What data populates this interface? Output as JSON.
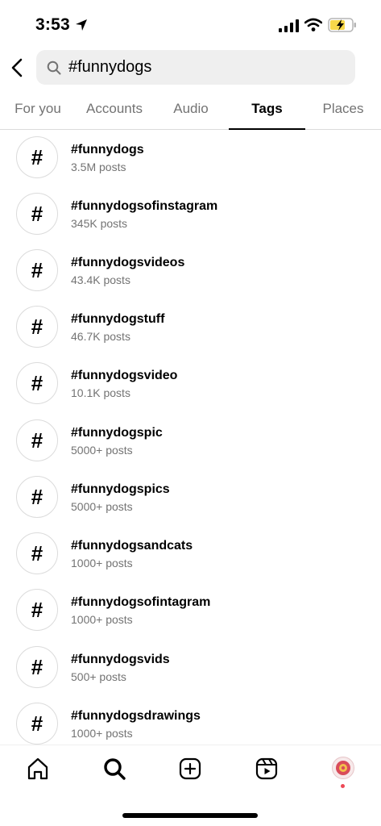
{
  "status_bar": {
    "time": "3:53"
  },
  "search": {
    "query": "#funnydogs"
  },
  "tabs": [
    {
      "label": "For you",
      "active": false
    },
    {
      "label": "Accounts",
      "active": false
    },
    {
      "label": "Audio",
      "active": false
    },
    {
      "label": "Tags",
      "active": true
    },
    {
      "label": "Places",
      "active": false
    }
  ],
  "results": [
    {
      "symbol": "#",
      "name": "#funnydogs",
      "count": "3.5M posts"
    },
    {
      "symbol": "#",
      "name": "#funnydogsofinstagram",
      "count": "345K posts"
    },
    {
      "symbol": "#",
      "name": "#funnydogsvideos",
      "count": "43.4K posts"
    },
    {
      "symbol": "#",
      "name": "#funnydogstuff",
      "count": "46.7K posts"
    },
    {
      "symbol": "#",
      "name": "#funnydogsvideo",
      "count": "10.1K posts"
    },
    {
      "symbol": "#",
      "name": "#funnydogspic",
      "count": "5000+ posts"
    },
    {
      "symbol": "#",
      "name": "#funnydogspics",
      "count": "5000+ posts"
    },
    {
      "symbol": "#",
      "name": "#funnydogsandcats",
      "count": "1000+ posts"
    },
    {
      "symbol": "#",
      "name": "#funnydogsofintagram",
      "count": "1000+ posts"
    },
    {
      "symbol": "#",
      "name": "#funnydogsvids",
      "count": "500+ posts"
    },
    {
      "symbol": "#",
      "name": "#funnydogsdrawings",
      "count": "1000+ posts"
    }
  ],
  "bottom_nav": {
    "items": [
      "home-icon",
      "search-icon",
      "create-icon",
      "reels-icon",
      "profile-avatar"
    ],
    "active": "search-icon",
    "notification_dot_color": "#ed4956"
  },
  "colors": {
    "accent_text": "#000000",
    "secondary_text": "#737373",
    "search_bg": "#efefef",
    "battery_fill": "#f7d84a"
  }
}
